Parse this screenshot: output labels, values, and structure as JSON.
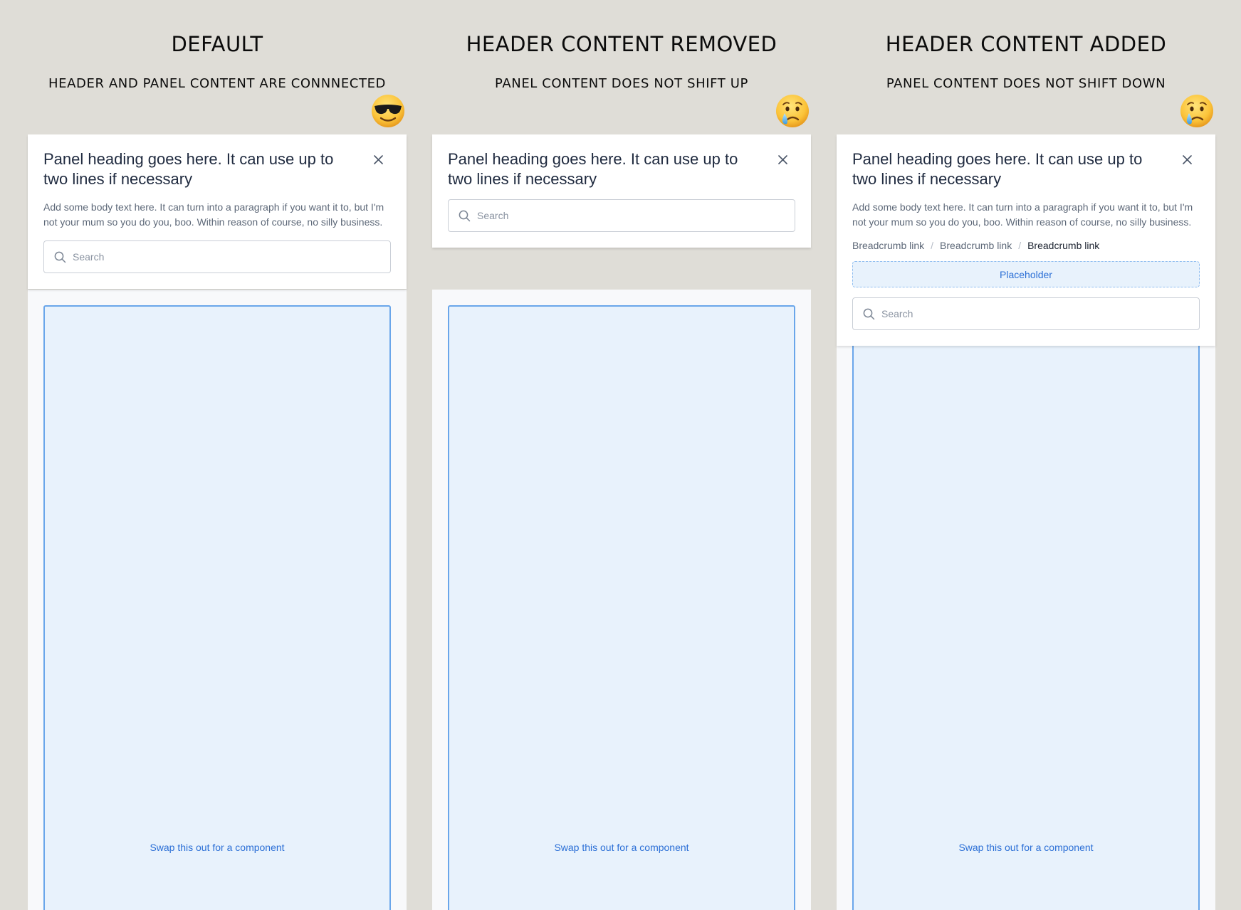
{
  "columns": [
    {
      "title": "DEFAULT",
      "subtitle": "HEADER AND PANEL CONTENT ARE CONNNECTED",
      "emoji": "smiling-face-with-sunglasses",
      "panel": {
        "heading": "Panel heading goes here. It can use up to two lines if necessary",
        "body_text": "Add some body text here. It can turn into a paragraph if you want it to, but I'm not your mum so you do you, boo. Within reason of course, no silly business.",
        "search": {
          "value": "",
          "placeholder": "Search"
        },
        "component_label": "Swap this out for a component"
      }
    },
    {
      "title": "HEADER CONTENT REMOVED",
      "subtitle": "PANEL CONTENT DOES NOT SHIFT UP",
      "emoji": "crying-face",
      "panel": {
        "heading": "Panel heading goes here. It can use up to two lines if necessary",
        "search": {
          "value": "",
          "placeholder": "Search"
        },
        "component_label": "Swap this out for a component"
      }
    },
    {
      "title": "HEADER CONTENT ADDED",
      "subtitle": "PANEL CONTENT DOES NOT SHIFT DOWN",
      "emoji": "crying-face",
      "panel": {
        "heading": "Panel heading goes here. It can use up to two lines if necessary",
        "body_text": "Add some body text here. It can turn into a paragraph if you want it to, but I'm not your mum so you do you, boo. Within reason of course, no silly business.",
        "breadcrumb": [
          "Breadcrumb link",
          "Breadcrumb link",
          "Breadcrumb link"
        ],
        "breadcrumb_separator": "/",
        "placeholder_label": "Placeholder",
        "search": {
          "value": "",
          "placeholder": "Search"
        },
        "component_label": "Swap this out for a component"
      }
    }
  ],
  "colors": {
    "page_background": "#dfddd7",
    "header_background": "#ffffff",
    "body_background": "#f8f9fb",
    "component_fill": "#e8f2fc",
    "component_border": "#6aa6ea",
    "accent_text": "#2b6fd6",
    "heading_text": "#1f2a3f",
    "body_text": "#5d6878"
  }
}
